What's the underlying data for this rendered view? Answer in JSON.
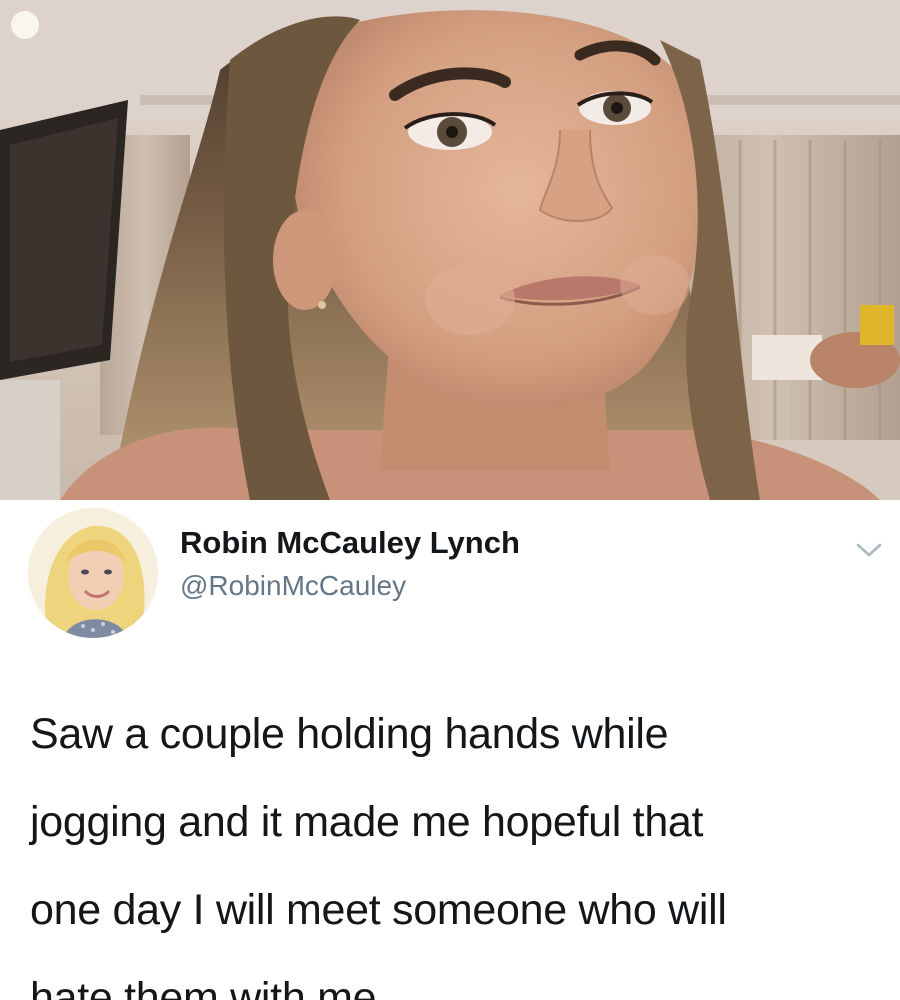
{
  "photo": {
    "description_icon": "photo-of-woman-icon"
  },
  "tweet": {
    "display_name": "Robin McCauley Lynch",
    "handle": "@RobinMcCauley",
    "body_lines": [
      "Saw a couple holding hands while",
      "jogging and it made me hopeful that",
      "one day I will meet someone who will",
      "hate them with me."
    ],
    "menu_icon": "chevron-down-icon",
    "avatar_icon": "avatar-icon"
  },
  "colors": {
    "name_text": "#14171a",
    "handle_text": "#657786",
    "body_text": "#14171a",
    "chevron": "#aab8c2"
  }
}
